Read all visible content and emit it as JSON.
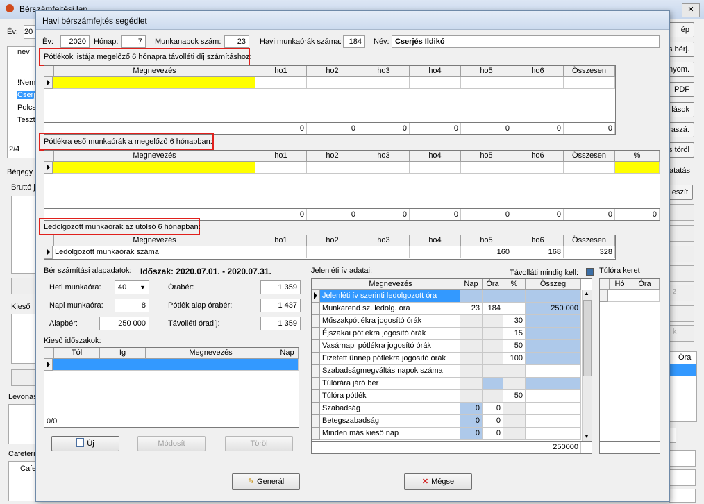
{
  "background": {
    "title": "Bérszámfejtési lap",
    "ev_label": "Év:",
    "ev_value": "20",
    "nev_col": "nev",
    "list_items": [
      "!Nem",
      "Cserj",
      "Polcs",
      "Teszt"
    ],
    "counter": "2/4",
    "tab_berjegy": "Bérjegy",
    "brutto": "Bruttó j",
    "kieso": "Kieső",
    "levonas": "Levonás",
    "cafeteria": "Cafeteri",
    "cafe_col": "Cafe",
    "right_buttons": [
      "ép",
      "s bérj.",
      "s nyom.",
      "PDF",
      "lások",
      "újraszá.",
      "s töröl"
    ],
    "tab_right": "atatás",
    "btn_right": "eszít",
    "right_col": "Óra",
    "faded_z": "z",
    "faded_k": "k"
  },
  "dialog": {
    "title": "Havi bérszámfejtés segédlet",
    "header": {
      "ev_label": "Év:",
      "ev": "2020",
      "honap_label": "Hónap:",
      "honap": "7",
      "munkanapok_label": "Munkanapok szám:",
      "munkanapok": "23",
      "munkaorak_label": "Havi munkaórák száma:",
      "munkaorak": "184",
      "nev_label": "Név:",
      "nev": "Cserjés Ildikó"
    },
    "section1": {
      "title": "Pótlékok listája megelőző 6 hónapra távolléti díj számításhoz:",
      "columns": [
        "Megnevezés",
        "ho1",
        "ho2",
        "ho3",
        "ho4",
        "ho5",
        "ho6",
        "Összesen"
      ],
      "totals": [
        "0",
        "0",
        "0",
        "0",
        "0",
        "0",
        "0"
      ]
    },
    "section2": {
      "title": "Pótlékra eső munkaórák a megelőző 6 hónapban:",
      "columns": [
        "Megnevezés",
        "ho1",
        "ho2",
        "ho3",
        "ho4",
        "ho5",
        "ho6",
        "Összesen",
        "%"
      ],
      "totals": [
        "0",
        "0",
        "0",
        "0",
        "0",
        "0",
        "0",
        "0"
      ]
    },
    "section3": {
      "title": "Ledolgozott munkaórák az utolsó 6 hónapban:",
      "columns": [
        "Megnevezés",
        "ho1",
        "ho2",
        "ho3",
        "ho4",
        "ho5",
        "ho6",
        "Összesen"
      ],
      "row": [
        "Ledolgozott munkaórák száma",
        "",
        "",
        "",
        "",
        "160",
        "168",
        "328"
      ]
    },
    "ber": {
      "label": "Bér számítási alapadatok:",
      "idoszak": "Időszak: 2020.07.01. - 2020.07.31.",
      "heti_label": "Heti munkaóra:",
      "heti": "40",
      "napi_label": "Napi munkaóra:",
      "napi": "8",
      "alapber_label": "Alapbér:",
      "alapber": "250 000",
      "oraber_label": "Órabér:",
      "oraber": "1 359",
      "potlek_label": "Pótlék alap órabér:",
      "potlek": "1 437",
      "tavolleti_label": "Távolléti óradíj:",
      "tavolleti": "1 359"
    },
    "kieso": {
      "label": "Kieső időszakok:",
      "columns": [
        "Tól",
        "Ig",
        "Megnevezés",
        "Nap"
      ],
      "counter": "0/0"
    },
    "jelenleti": {
      "label": "Jelenléti ív adatai:",
      "tavolleti_label": "Távolláti mindig kell:",
      "columns": [
        "Megnevezés",
        "Nap",
        "Óra",
        "%",
        "Összeg"
      ],
      "rows": [
        {
          "name": "Jelenléti ív szerinti ledolgozott óra",
          "nap": "",
          "ora": "",
          "pct": "",
          "osszeg": ""
        },
        {
          "name": "Munkarend sz. ledolg. óra",
          "nap": "23",
          "ora": "184",
          "pct": "",
          "osszeg": "250 000"
        },
        {
          "name": "Műszakpótlékra jogosító órák",
          "nap": "",
          "ora": "",
          "pct": "30",
          "osszeg": ""
        },
        {
          "name": "Éjszakai pótlékra jogosító órák",
          "nap": "",
          "ora": "",
          "pct": "15",
          "osszeg": ""
        },
        {
          "name": "Vasárnapi pótlékra jogosító órák",
          "nap": "",
          "ora": "",
          "pct": "50",
          "osszeg": ""
        },
        {
          "name": "Fizetett ünnep pótlékra jogosító órák",
          "nap": "",
          "ora": "",
          "pct": "100",
          "osszeg": ""
        },
        {
          "name": "Szabadságmegváltás napok száma",
          "nap": "",
          "ora": "",
          "pct": "",
          "osszeg": ""
        },
        {
          "name": "Túlórára járó bér",
          "nap": "",
          "ora": "",
          "pct": "",
          "osszeg": ""
        },
        {
          "name": "Túlóra pótlék",
          "nap": "",
          "ora": "",
          "pct": "50",
          "osszeg": ""
        },
        {
          "name": "Szabadság",
          "nap": "0",
          "ora": "0",
          "pct": "",
          "osszeg": ""
        },
        {
          "name": "Betegszabadság",
          "nap": "0",
          "ora": "0",
          "pct": "",
          "osszeg": ""
        },
        {
          "name": "Minden más kieső nap",
          "nap": "0",
          "ora": "0",
          "pct": "",
          "osszeg": ""
        }
      ],
      "total": "250000"
    },
    "tulora": {
      "label": "Túlóra keret",
      "columns": [
        "Hó",
        "Óra"
      ]
    },
    "buttons": {
      "uj": "Új",
      "modosit": "Módosít",
      "torol": "Töröl",
      "general": "Generál",
      "megse": "Mégse"
    }
  }
}
